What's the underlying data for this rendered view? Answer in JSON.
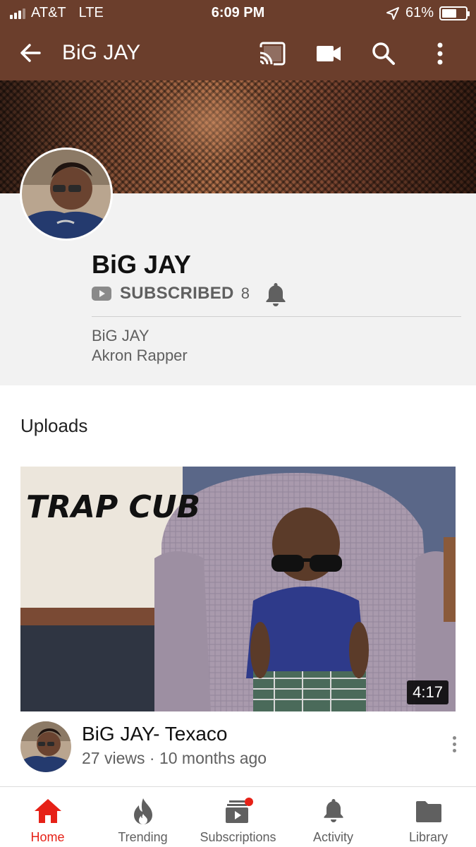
{
  "status_bar": {
    "carrier": "AT&T",
    "network": "LTE",
    "time": "6:09 PM",
    "battery": "61%",
    "battery_level": 0.61
  },
  "app_bar": {
    "title": "BiG JAY",
    "icons": [
      "back-arrow-icon",
      "cast-icon",
      "video-camera-icon",
      "search-icon",
      "more-vert-icon"
    ]
  },
  "channel": {
    "name": "BiG JAY",
    "subscribed_label": "SUBSCRIBED",
    "subscriber_count": "8",
    "description_lines": [
      "BiG JAY",
      "Akron Rapper"
    ]
  },
  "uploads": {
    "section_title": "Uploads",
    "videos": [
      {
        "thumbnail_text": "TRAP CUB",
        "duration": "4:17",
        "title": "BiG JAY- Texaco",
        "views": "27 views",
        "age": "10 months ago"
      }
    ]
  },
  "bottom_nav": {
    "items": [
      {
        "label": "Home",
        "icon": "home-icon",
        "active": true
      },
      {
        "label": "Trending",
        "icon": "flame-icon",
        "active": false
      },
      {
        "label": "Subscriptions",
        "icon": "subscriptions-icon",
        "active": false
      },
      {
        "label": "Activity",
        "icon": "bell-icon",
        "active": false
      },
      {
        "label": "Library",
        "icon": "folder-icon",
        "active": false
      }
    ]
  },
  "colors": {
    "header_brown": "#6b3e2c",
    "active_red": "#e62117",
    "secondary_text": "#606060"
  }
}
